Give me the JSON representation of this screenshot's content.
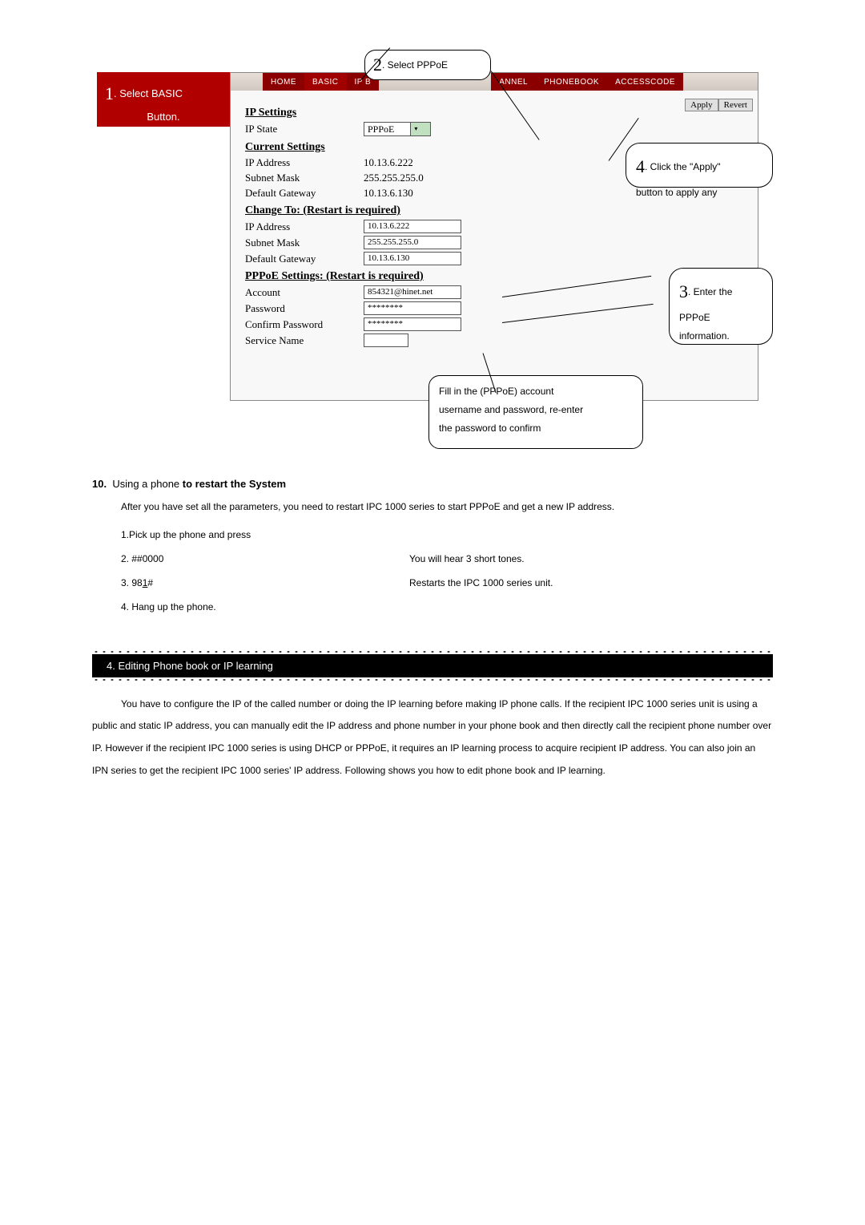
{
  "tabs": {
    "home": "HOME",
    "basic": "BASIC",
    "ipb": "IP B",
    "annel": "ANNEL",
    "phonebook": "PHONEBOOK",
    "accesscode": "ACCESSCODE"
  },
  "buttons": {
    "apply": "Apply",
    "revert": "Revert"
  },
  "sidebar": {
    "step1_num": "1",
    "step1_txt": ". Select BASIC",
    "step1_line2": "Button."
  },
  "co2": {
    "num": "2",
    "txt": ". Select PPPoE"
  },
  "co4": {
    "num": "4",
    "txt_a": ". Click the \"Apply\"",
    "txt_b": "button to apply any"
  },
  "co3": {
    "num": "3",
    "txt_a": ". Enter the",
    "txt_b": "PPPoE",
    "txt_c": "information."
  },
  "co_fill": {
    "l1": "Fill in the (PPPoE) account",
    "l2": "username and password, re-enter",
    "l3": "the password to confirm"
  },
  "ip": {
    "h_settings": "IP Settings",
    "ip_state": "IP State",
    "ip_state_val": "PPPoE",
    "h_current": "Current Settings",
    "ip_addr_l": "IP Address",
    "ip_addr_v": "10.13.6.222",
    "mask_l": "Subnet Mask",
    "mask_v": "255.255.255.0",
    "gw_l": "Default Gateway",
    "gw_v": "10.13.6.130",
    "h_change": "Change To: (Restart is required)",
    "c_ip_v": "10.13.6.222",
    "c_mask_v": "255.255.255.0",
    "c_gw_v": "10.13.6.130",
    "h_pppoe": "PPPoE Settings: (Restart is required)",
    "acc_l": "Account",
    "acc_v": "854321@hinet.net",
    "pw_l": "Password",
    "pw_v": "********",
    "cpw_l": "Confirm Password",
    "cpw_v": "********",
    "svc_l": "Service Name",
    "svc_v": ""
  },
  "sec10": {
    "num": "10.",
    "mid": "Using a phone ",
    "bold": "to restart the System",
    "intro": "After you have set all the parameters, you need to restart IPC 1000 series to start PPPoE and get a new IP address.",
    "s1": "1.Pick up the phone and press",
    "s2l": "2. ##0000",
    "s2r": "You will hear 3 short tones.",
    "s3l_pre": "3. 98",
    "s3l_u": "1",
    "s3l_post": "#",
    "s3r": "Restarts the IPC 1000 series unit.",
    "s4": "4. Hang up the phone."
  },
  "sec4": {
    "title": "4. Editing Phone book or IP learning",
    "body": "You have to configure the IP of the called number or doing the IP learning before making IP phone calls. If the recipient IPC 1000 series unit is using a public and static IP address, you can manually edit the IP address and phone number in your phone book and then directly call the recipient phone number over IP. However if the recipient IPC 1000 series is using DHCP or PPPoE, it requires an IP learning process to acquire recipient IP address. You can also join an IPN series to get the recipient IPC 1000 series' IP address. Following shows you how to edit phone book and IP learning."
  }
}
